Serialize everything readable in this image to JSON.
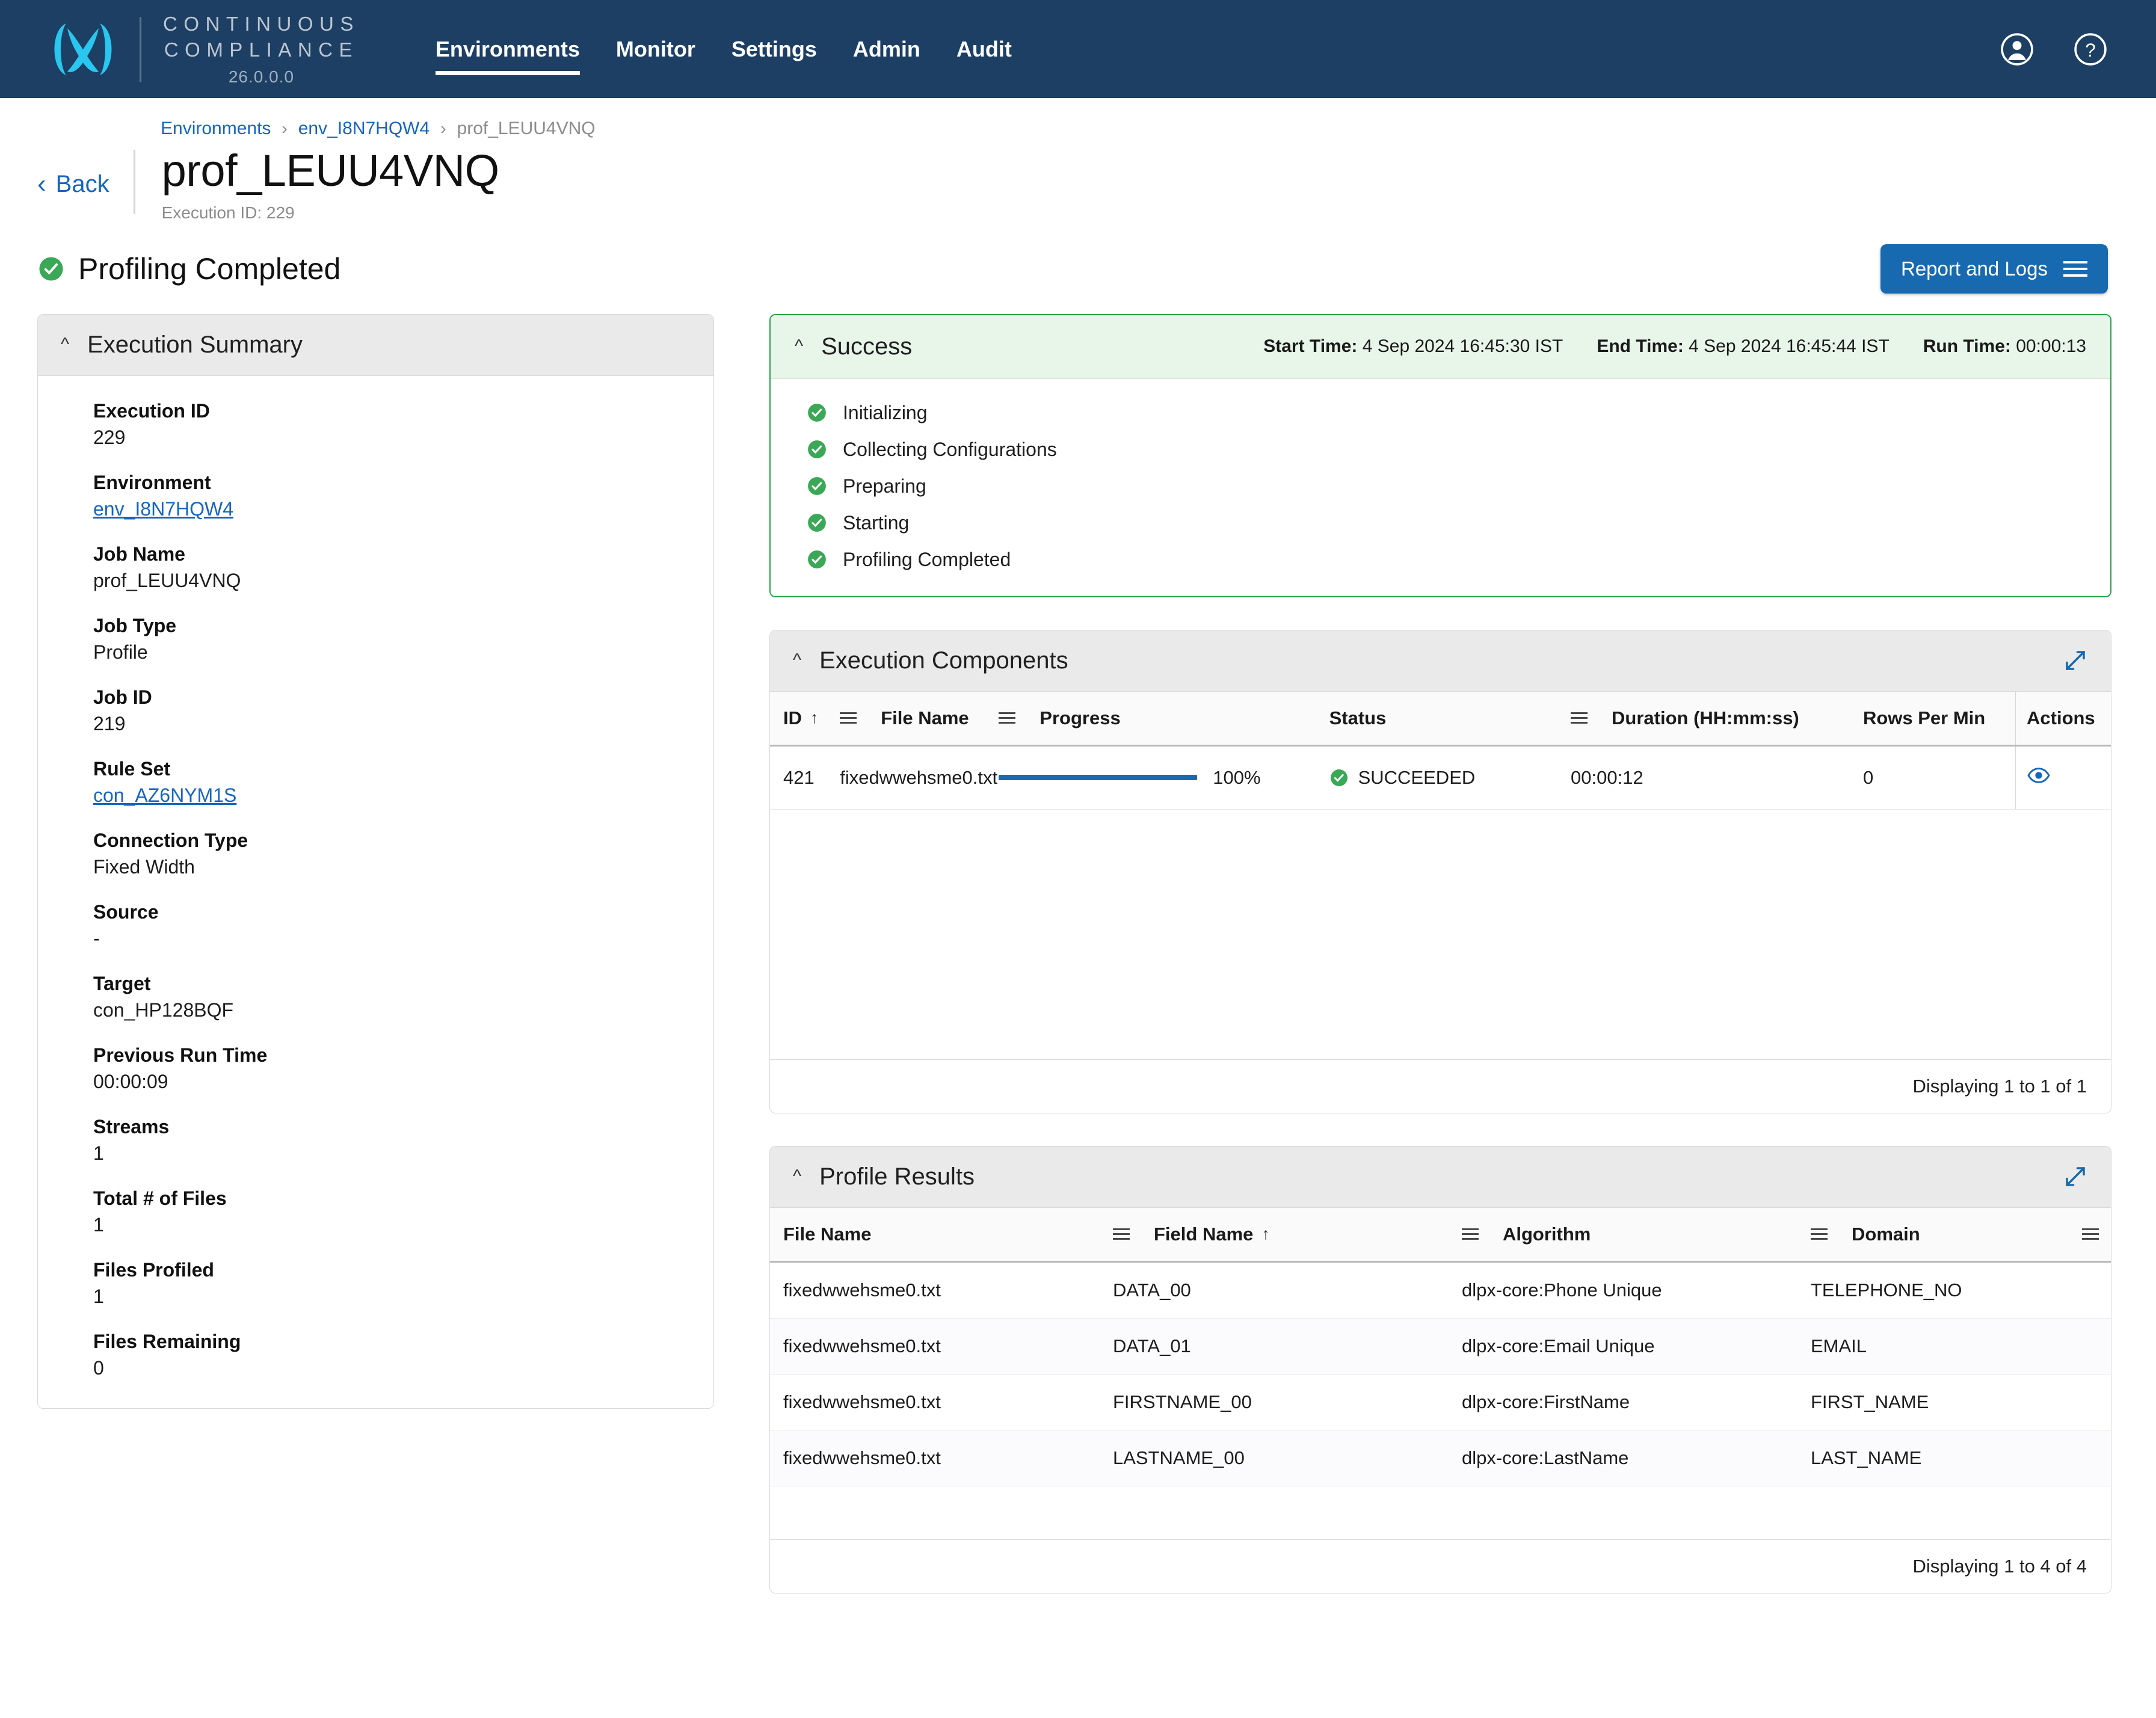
{
  "brand": {
    "line1": "CONTINUOUS",
    "line2": "COMPLIANCE",
    "version": "26.0.0.0",
    "logo_icon": "infinity-x-logo-icon"
  },
  "nav": {
    "links": [
      {
        "label": "Environments",
        "active": true
      },
      {
        "label": "Monitor",
        "active": false
      },
      {
        "label": "Settings",
        "active": false
      },
      {
        "label": "Admin",
        "active": false
      },
      {
        "label": "Audit",
        "active": false
      }
    ],
    "account_icon": "account-circle-icon",
    "help_icon": "help-circle-icon"
  },
  "breadcrumb": {
    "items": [
      {
        "label": "Environments",
        "link": true
      },
      {
        "label": "env_I8N7HQW4",
        "link": true
      },
      {
        "label": "prof_LEUU4VNQ",
        "link": false
      }
    ],
    "separator": "›"
  },
  "back": {
    "label": "Back",
    "icon": "chevron-left-icon"
  },
  "page": {
    "title": "prof_LEUU4VNQ",
    "execution_id_label": "Execution ID: 229"
  },
  "status": {
    "text": "Profiling Completed",
    "icon": "success-check-icon",
    "color": "#3aa856"
  },
  "report_button": {
    "label": "Report and Logs",
    "icon": "hamburger-menu-icon"
  },
  "execution_summary": {
    "title": "Execution Summary",
    "collapse_icon": "chevron-up-icon",
    "fields": [
      {
        "label": "Execution ID",
        "value": "229",
        "link": false
      },
      {
        "label": "Environment",
        "value": "env_I8N7HQW4",
        "link": true
      },
      {
        "label": "Job Name",
        "value": "prof_LEUU4VNQ",
        "link": false
      },
      {
        "label": "Job Type",
        "value": "Profile",
        "link": false
      },
      {
        "label": "Job ID",
        "value": "219",
        "link": false
      },
      {
        "label": "Rule Set",
        "value": "con_AZ6NYM1S",
        "link": true
      },
      {
        "label": "Connection Type",
        "value": "Fixed Width",
        "link": false
      },
      {
        "label": "Source",
        "value": "-",
        "link": false
      },
      {
        "label": "Target",
        "value": "con_HP128BQF",
        "link": false
      },
      {
        "label": "Previous Run Time",
        "value": "00:00:09",
        "link": false
      },
      {
        "label": "Streams",
        "value": "1",
        "link": false
      },
      {
        "label": "Total # of Files",
        "value": "1",
        "link": false
      },
      {
        "label": "Files Profiled",
        "value": "1",
        "link": false
      },
      {
        "label": "Files Remaining",
        "value": "0",
        "link": false
      }
    ]
  },
  "success_panel": {
    "title": "Success",
    "collapse_icon": "chevron-up-icon",
    "start_time_label": "Start Time:",
    "start_time_value": "4 Sep 2024 16:45:30 IST",
    "end_time_label": "End Time:",
    "end_time_value": "4 Sep 2024 16:45:44 IST",
    "run_time_label": "Run Time:",
    "run_time_value": "00:00:13",
    "steps": [
      "Initializing",
      "Collecting Configurations",
      "Preparing",
      "Starting",
      "Profiling Completed"
    ]
  },
  "execution_components": {
    "title": "Execution Components",
    "collapse_icon": "chevron-up-icon",
    "expand_icon": "expand-diagonal-icon",
    "columns": [
      {
        "label": "ID",
        "sort": "↑",
        "menu": true
      },
      {
        "label": "File Name",
        "sort": "",
        "menu": true
      },
      {
        "label": "Progress",
        "sort": "",
        "menu": false
      },
      {
        "label": "Status",
        "sort": "",
        "menu": true
      },
      {
        "label": "Duration (HH:mm:ss)",
        "sort": "",
        "menu": false
      },
      {
        "label": "Rows Per Min",
        "sort": "",
        "menu": false
      },
      {
        "label": "Actions",
        "sort": "",
        "menu": false
      }
    ],
    "rows": [
      {
        "id": "421",
        "file_name": "fixedwwehsme0.txt",
        "progress_pct": 100,
        "progress_label": "100%",
        "status": "SUCCEEDED",
        "duration": "00:00:12",
        "rows_per_min": "0",
        "action_icon": "eye-view-icon"
      }
    ],
    "footer": "Displaying 1 to 1 of 1"
  },
  "profile_results": {
    "title": "Profile Results",
    "collapse_icon": "chevron-up-icon",
    "expand_icon": "expand-diagonal-icon",
    "columns": [
      {
        "label": "File Name",
        "sort": "",
        "menu": true
      },
      {
        "label": "Field Name",
        "sort": "↑",
        "menu": true
      },
      {
        "label": "Algorithm",
        "sort": "",
        "menu": true
      },
      {
        "label": "Domain",
        "sort": "",
        "menu": true
      }
    ],
    "rows": [
      {
        "file_name": "fixedwwehsme0.txt",
        "field_name": "DATA_00",
        "algorithm": "dlpx-core:Phone Unique",
        "domain": "TELEPHONE_NO"
      },
      {
        "file_name": "fixedwwehsme0.txt",
        "field_name": "DATA_01",
        "algorithm": "dlpx-core:Email Unique",
        "domain": "EMAIL"
      },
      {
        "file_name": "fixedwwehsme0.txt",
        "field_name": "FIRSTNAME_00",
        "algorithm": "dlpx-core:FirstName",
        "domain": "FIRST_NAME"
      },
      {
        "file_name": "fixedwwehsme0.txt",
        "field_name": "LASTNAME_00",
        "algorithm": "dlpx-core:LastName",
        "domain": "LAST_NAME"
      }
    ],
    "footer": "Displaying 1 to 4 of 4"
  },
  "colors": {
    "nav_bg": "#1d3f64",
    "accent_blue": "#1769b0",
    "link_blue": "#1565c0",
    "success_green": "#2e9e4d",
    "success_bg": "#e8f5e9"
  }
}
